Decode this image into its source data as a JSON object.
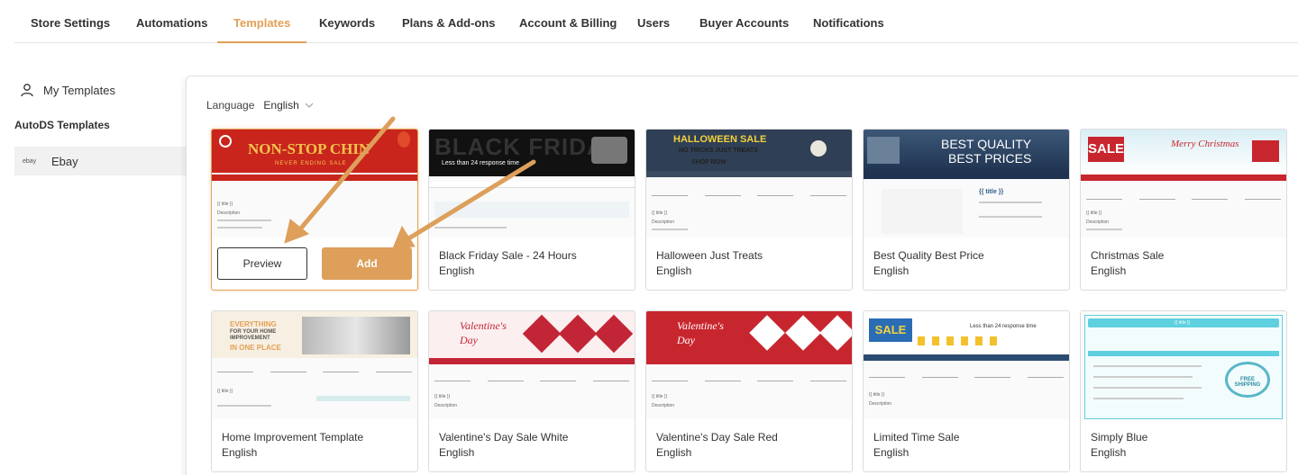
{
  "nav": {
    "tabs": [
      {
        "label": "Store Settings"
      },
      {
        "label": "Automations"
      },
      {
        "label": "Templates"
      },
      {
        "label": "Keywords"
      },
      {
        "label": "Plans & Add-ons"
      },
      {
        "label": "Account & Billing"
      },
      {
        "label": "Users"
      },
      {
        "label": "Buyer Accounts"
      },
      {
        "label": "Notifications"
      }
    ],
    "active_tab": "Templates"
  },
  "sidebar": {
    "my_templates": "My Templates",
    "autods_heading": "AutoDS Templates",
    "ebay_logo": "ebay",
    "ebay_label": "Ebay"
  },
  "language": {
    "label": "Language",
    "value": "English"
  },
  "buttons": {
    "preview": "Preview",
    "add": "Add"
  },
  "colors": {
    "accent": "#e2a055",
    "add_button": "#dd9f5a"
  },
  "thumb_text": {
    "nonstop": "NON-STOP CHIN",
    "never": "NEVER ENDING SALE",
    "black_friday": "BLACK FRIDAY",
    "bf_sub": "Less than 24 response time",
    "halloween": "HALLOWEEN SALE",
    "halloween_sub": "NO TRICKS JUST TREATS",
    "shop_now": "SHOP NOW",
    "best_quality": "BEST QUALITY",
    "best_prices": "BEST PRICES",
    "sale": "SALE",
    "merry": "Merry Christmas",
    "everything": "EVERYTHING",
    "for_home": "FOR YOUR HOME",
    "improvement": "IMPROVEMENT",
    "in_one": "IN ONE PLACE",
    "valentines": "Valentine's Day",
    "free_shipping": "FREE SHIPPING",
    "title_tag": "{{ title }}",
    "description": "Description"
  },
  "templates": [
    {
      "title": "",
      "language": ""
    },
    {
      "title": "Black Friday Sale - 24 Hours",
      "language": "English"
    },
    {
      "title": "Halloween Just Treats",
      "language": "English"
    },
    {
      "title": "Best Quality Best Price",
      "language": "English"
    },
    {
      "title": "Christmas Sale",
      "language": "English"
    },
    {
      "title": "Home Improvement Template",
      "language": "English"
    },
    {
      "title": "Valentine's Day Sale White",
      "language": "English"
    },
    {
      "title": "Valentine's Day Sale Red",
      "language": "English"
    },
    {
      "title": "Limited Time Sale",
      "language": "English"
    },
    {
      "title": "Simply Blue",
      "language": "English"
    }
  ]
}
